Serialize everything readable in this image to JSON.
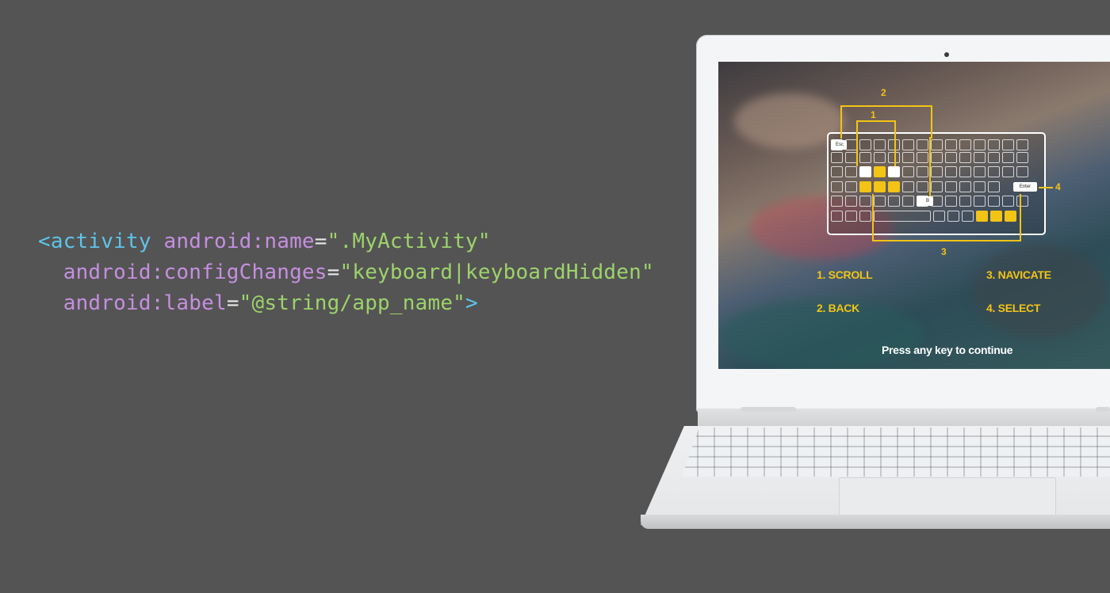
{
  "code": {
    "line1": {
      "tag_open": "<activity",
      "attr": "android:name",
      "eq": "=",
      "value": "\".MyActivity\""
    },
    "line2": {
      "attr": "android:configChanges",
      "eq": "=",
      "value": "\"keyboard|keyboardHidden\""
    },
    "line3": {
      "attr": "android:label",
      "eq": "=",
      "value": "\"@string/app_name\"",
      "tag_close": ">"
    }
  },
  "screen": {
    "keys": {
      "esc": "Esc",
      "enter": "Enter",
      "b": "B"
    },
    "callouts": {
      "c1": "1",
      "c2": "2",
      "c3": "3",
      "c4": "4"
    },
    "legend": {
      "scroll": "1. SCROLL",
      "navigate": "3. NAVICATE",
      "back": "2. BACK",
      "select": "4. SELECT"
    },
    "prompt": "Press any key to continue"
  },
  "colors": {
    "background": "#545454",
    "tag": "#5ec4e8",
    "attr": "#c58fe0",
    "string": "#9dd36a",
    "accent": "#f2c416"
  }
}
